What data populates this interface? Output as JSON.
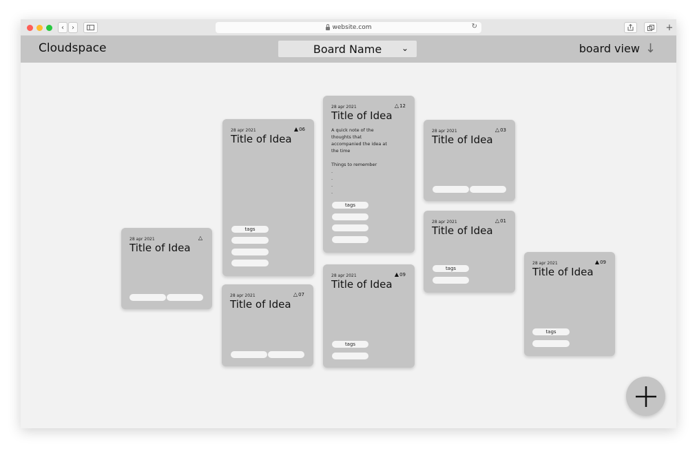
{
  "browser": {
    "url": "website.com",
    "nav_back": "‹",
    "nav_forward": "›",
    "new_tab": "+"
  },
  "app": {
    "brand": "Cloudspace",
    "board_name": "Board Name",
    "view_label": "board view"
  },
  "colors": {
    "card": "#c4c4c4",
    "canvas": "#f2f2f2",
    "traffic_red": "#ff5f57",
    "traffic_yellow": "#febc2e",
    "traffic_green": "#28c840"
  },
  "cards": [
    {
      "date": "28 apr 2021",
      "title": "Title of Idea",
      "votes": "",
      "voted": false
    },
    {
      "date": "28 apr 2021",
      "title": "Title of Idea",
      "votes": "06",
      "voted": true,
      "tag": "tags"
    },
    {
      "date": "28 apr 2021",
      "title": "Title of Idea",
      "votes": "07",
      "voted": false
    },
    {
      "date": "28 apr 2021",
      "title": "Title of Idea",
      "votes": "12",
      "voted": false,
      "note": "A quick note of the\nthoughts that\naccompanied the idea at\nthe time\n\nThings to remember\n.\n.\n.\n.",
      "tag": "tags"
    },
    {
      "date": "28 apr 2021",
      "title": "Title of Idea",
      "votes": "09",
      "voted": true,
      "tag": "tags"
    },
    {
      "date": "28 apr 2021",
      "title": "Title of Idea",
      "votes": "03",
      "voted": false
    },
    {
      "date": "28 apr 2021",
      "title": "Title of Idea",
      "votes": "01",
      "voted": false,
      "tag": "tags"
    },
    {
      "date": "28 apr 2021",
      "title": "Title of Idea",
      "votes": "09",
      "voted": true,
      "tag": "tags"
    }
  ]
}
